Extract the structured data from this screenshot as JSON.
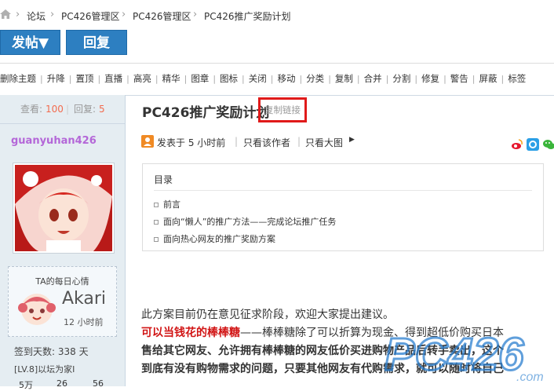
{
  "breadcrumb": {
    "items": [
      "论坛",
      "PC426管理区",
      "PC426管理区",
      "PC426推广奖励计划"
    ]
  },
  "actions": {
    "post_label": "发帖▼",
    "reply_label": "回复"
  },
  "toolbar": {
    "items": [
      "删除主题",
      "升降",
      "置顶",
      "直播",
      "高亮",
      "精华",
      "图章",
      "图标",
      "关闭",
      "移动",
      "分类",
      "复制",
      "合并",
      "分割",
      "修复",
      "警告",
      "屏蔽",
      "标签"
    ]
  },
  "sidebar": {
    "views_label": "查看:",
    "views": "100",
    "replies_label": "回复:",
    "replies": "5",
    "username": "guanyuhan426",
    "mood_title": "TA的每日心情",
    "mood_name": "Akari",
    "mood_time": "12 小时前",
    "sign_days": "签到天数: 338 天",
    "level": "[LV.8]以坛为家I",
    "bottom_stats": [
      "5万",
      "26",
      "56"
    ]
  },
  "thread": {
    "title": "PC426推广奖励计划",
    "copy_link": "复制链接",
    "posted": "发表于 5 小时前",
    "only_author": "只看该作者",
    "big_image": "只看大图"
  },
  "toc": {
    "heading": "目录",
    "items": [
      "前言",
      "面向“懒人”的推广方法——完成论坛推广任务",
      "面向热心网友的推广奖励方案"
    ]
  },
  "content": {
    "line1": "此方案目前仍在意见征求阶段，欢迎大家提出建议。",
    "line2_red": "可以当钱花的棒棒糖",
    "line2_rest": "——棒棒糖除了可以折算为现金、得到超低价购买日本",
    "line3": "售给其它网友、允许拥有棒棒糖的网友低价买进购物产品后转手卖出，这个",
    "line4": "到底有没有购物需求的问题，只要其他网友有代购需求，就可以随时将自己"
  },
  "watermark": {
    "text": "PC426",
    "sub": ".com"
  },
  "colors": {
    "accent": "#2d7fc1",
    "highlight": "#e01a1a",
    "username": "#b467d8"
  }
}
